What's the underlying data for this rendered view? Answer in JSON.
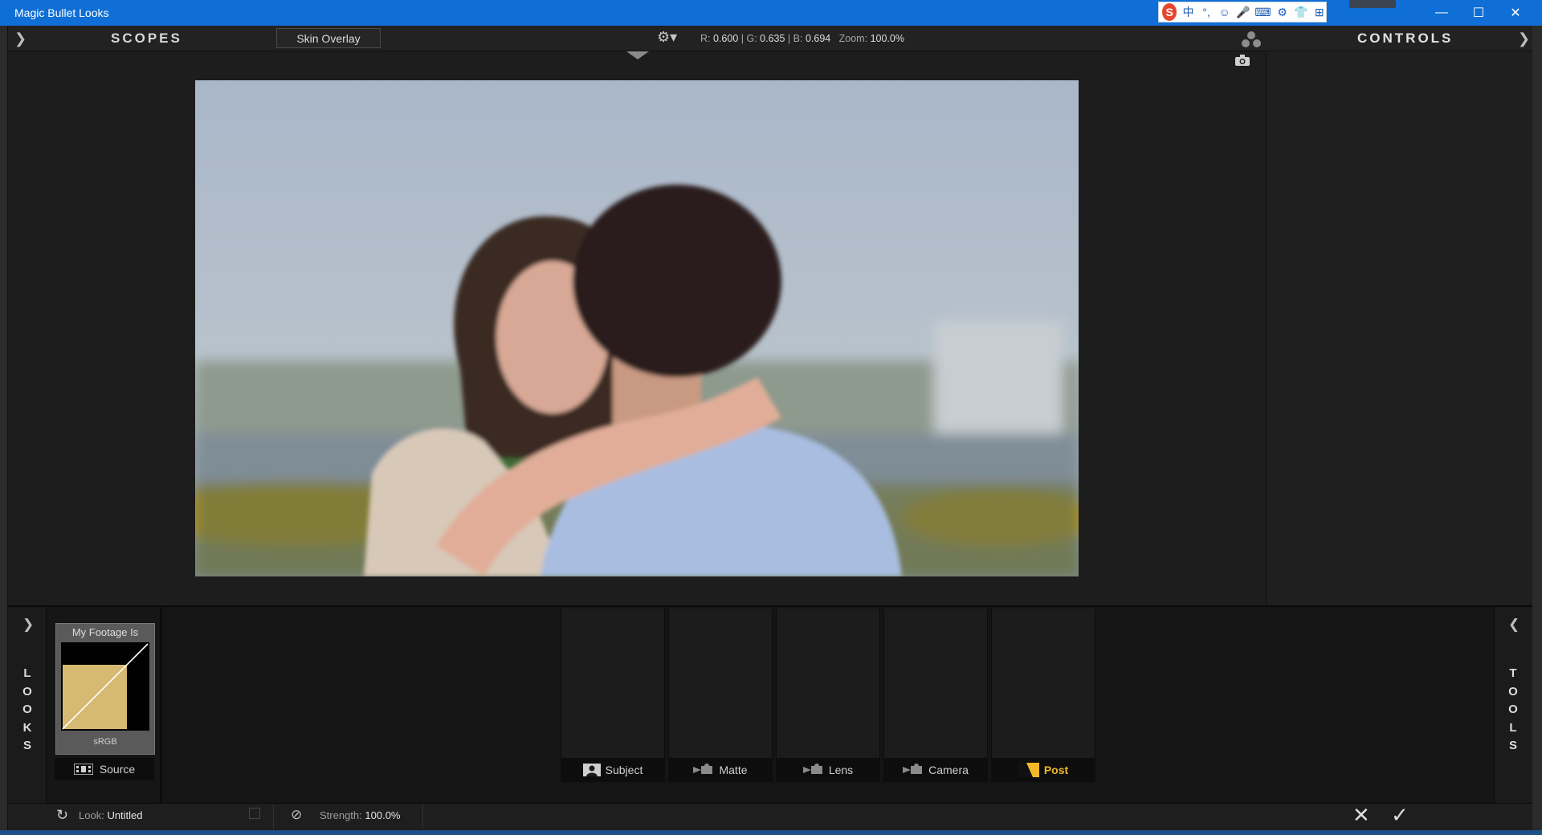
{
  "window": {
    "title": "Magic Bullet Looks",
    "minimize_icon": "minimize-icon",
    "maximize_icon": "maximize-icon",
    "close_icon": "close-icon"
  },
  "ime_toolbar": {
    "items": [
      "S",
      "中",
      "°,",
      "☺",
      "🎤",
      "⌨",
      "⚙",
      "👕",
      "⊞"
    ]
  },
  "header": {
    "scopes_label": "SCOPES",
    "skin_overlay_label": "Skin Overlay",
    "readout": {
      "r_label": "R:",
      "r": "0.600",
      "g_label": "G:",
      "g": "0.635",
      "b_label": "B:",
      "b": "0.694",
      "zoom_label": "Zoom:",
      "zoom": "100.0%"
    },
    "controls_label": "CONTROLS"
  },
  "looks_panel": {
    "rail_label": "LOOKS",
    "footage_title": "My Footage Is",
    "footage_sub": "sRGB",
    "source_label": "Source"
  },
  "tools_panel": {
    "rail_label": "TOOLS",
    "tabs": [
      {
        "label": "Subject",
        "icon": "subject-icon"
      },
      {
        "label": "Matte",
        "icon": "matte-icon"
      },
      {
        "label": "Lens",
        "icon": "lens-icon"
      },
      {
        "label": "Camera",
        "icon": "camera-tab-icon"
      },
      {
        "label": "Post",
        "icon": "post-icon",
        "active": true
      }
    ]
  },
  "status": {
    "look_label": "Look:",
    "look_value": "Untitled",
    "strength_label": "Strength:",
    "strength_value": "100.0%"
  },
  "colors": {
    "titlebar": "#0f6fd6",
    "accent_active": "#f2b82a",
    "footage_swatch": "#d6ba72"
  }
}
